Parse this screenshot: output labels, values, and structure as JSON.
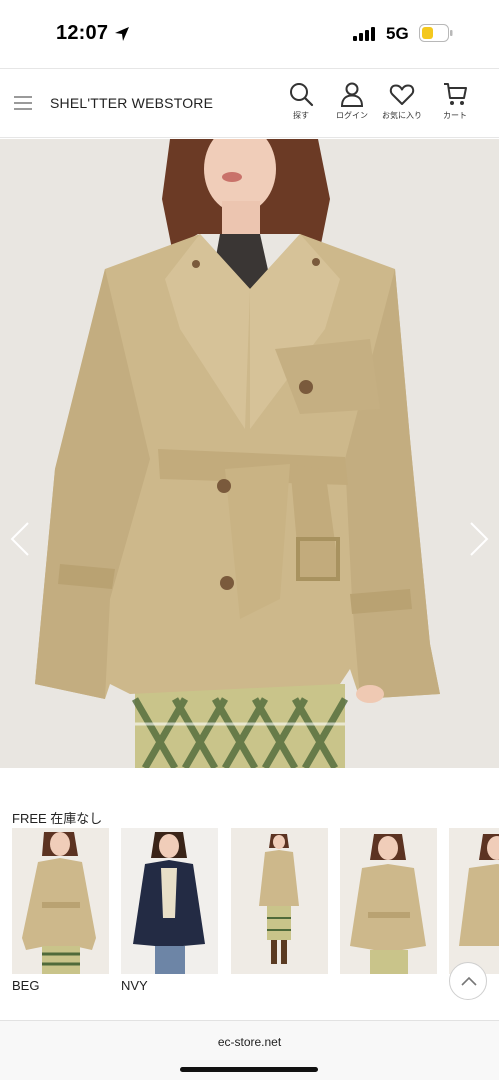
{
  "status": {
    "time": "12:07",
    "network": "5G"
  },
  "header": {
    "brand": "SHEL'TTER WEBSTORE",
    "actions": [
      {
        "label": "探す",
        "icon": "search-icon"
      },
      {
        "label": "ログイン",
        "icon": "user-icon"
      },
      {
        "label": "お気に入り",
        "icon": "heart-icon"
      },
      {
        "label": "カート",
        "icon": "cart-icon"
      }
    ]
  },
  "product": {
    "stock_status": "FREE 在庫なし",
    "colors": [
      {
        "code": "BEG",
        "selected": true
      },
      {
        "code": "NVY",
        "selected": false
      },
      {
        "code": "",
        "selected": false
      },
      {
        "code": "",
        "selected": false
      },
      {
        "code": "",
        "selected": false
      }
    ]
  },
  "browser": {
    "url": "ec-store.net"
  },
  "theme": {
    "accent": "#ecc94b",
    "coat_beige": "#cdb88b",
    "coat_navy": "#232b44"
  }
}
